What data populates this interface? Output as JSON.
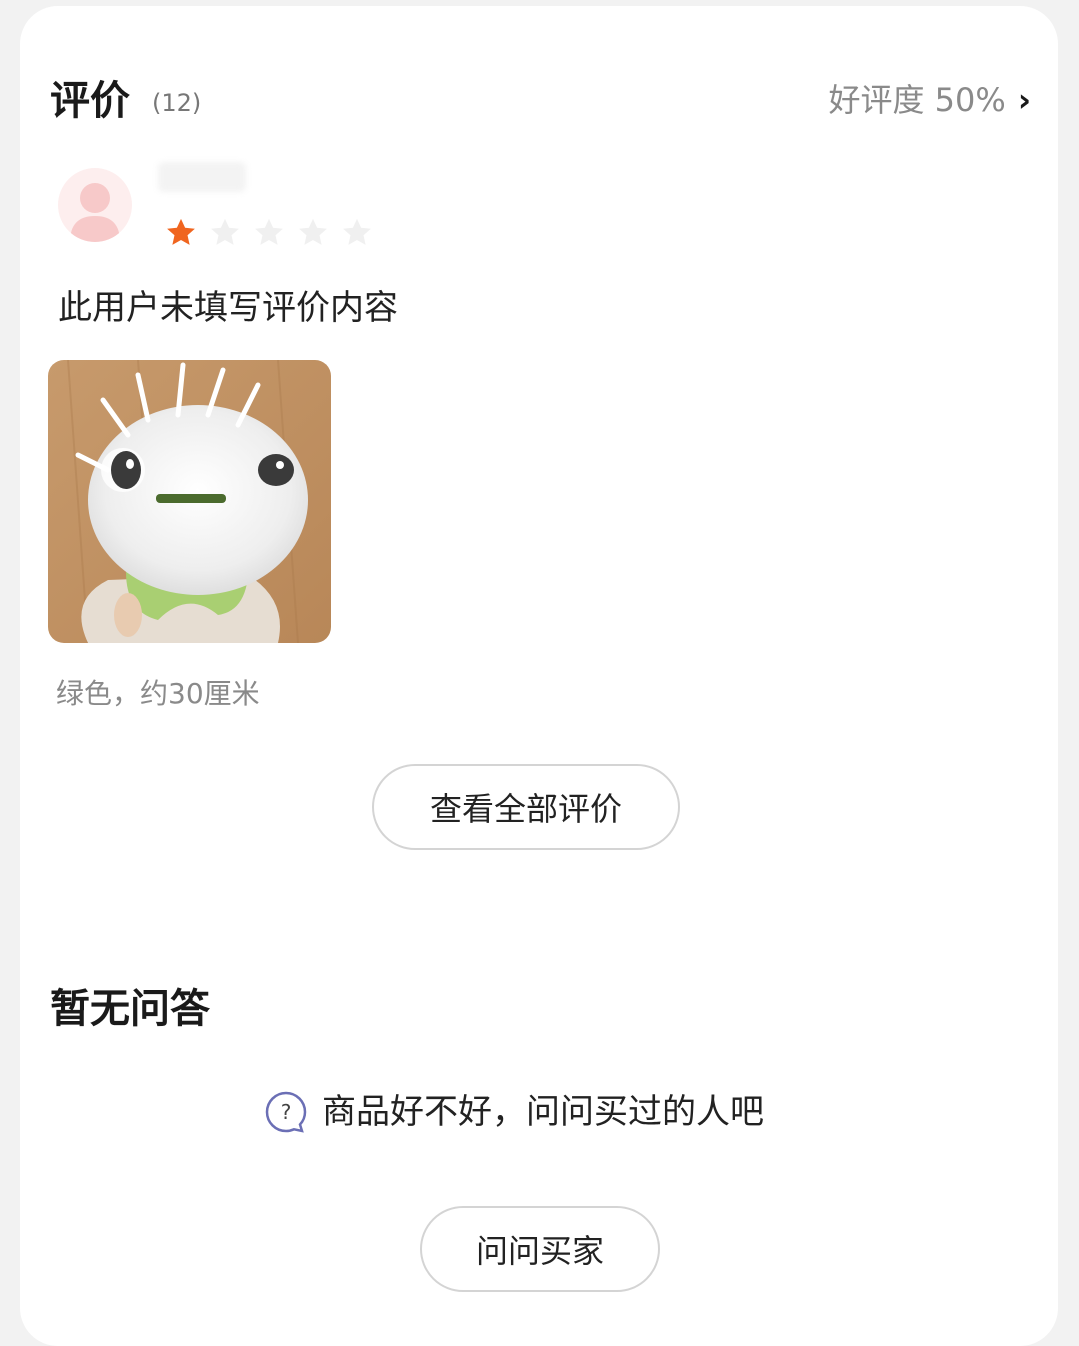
{
  "reviews": {
    "title": "评价",
    "count": "(12)",
    "rating_label": "好评度 50%",
    "rating_chevron": "›",
    "items": [
      {
        "stars": 1,
        "max_stars": 5,
        "content": "此用户未填写评价内容",
        "spec": "绿色，约30厘米"
      }
    ],
    "view_all_label": "查看全部评价"
  },
  "qa": {
    "title": "暂无问答",
    "hint_icon": "question-icon",
    "hint": "商品好不好，问问买过的人吧",
    "ask_label": "问问买家"
  },
  "colors": {
    "star_active": "#f0651f",
    "star_inactive": "#f0f0f0",
    "muted_text": "#8a8a8a",
    "icon_blue": "#6b6fb5"
  }
}
